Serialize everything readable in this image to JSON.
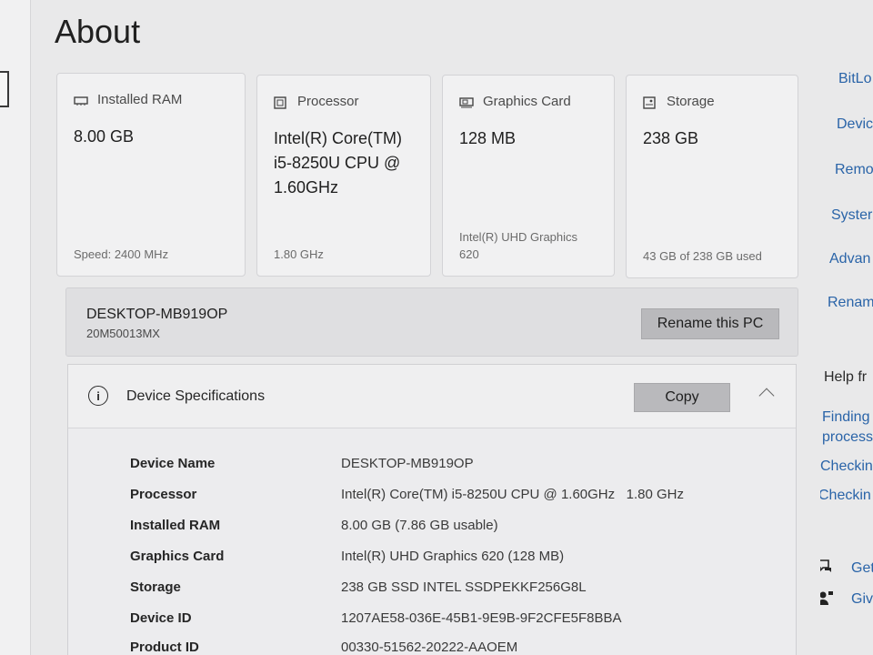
{
  "page": {
    "title": "About"
  },
  "cards": [
    {
      "icon": "ram-icon",
      "label": "Installed RAM",
      "value": "8.00 GB",
      "footer": "Speed: 2400 MHz"
    },
    {
      "icon": "processor-icon",
      "label": "Processor",
      "value_lines": [
        "Intel(R) Core(TM)",
        "i5-8250U CPU @",
        "1.60GHz"
      ],
      "footer": "1.80 GHz"
    },
    {
      "icon": "graphics-card-icon",
      "label": "Graphics Card",
      "value": "128 MB",
      "footer_lines": [
        "Intel(R) UHD Graphics",
        "620"
      ]
    },
    {
      "icon": "storage-icon",
      "label": "Storage",
      "value": "238 GB",
      "footer": "43 GB of 238 GB used"
    }
  ],
  "device": {
    "name": "DESKTOP-MB919OP",
    "model": "20M50013MX",
    "rename_label": "Rename this PC"
  },
  "specs": {
    "title": "Device Specifications",
    "copy_label": "Copy",
    "rows": [
      {
        "label": "Device Name",
        "value": "DESKTOP-MB919OP"
      },
      {
        "label": "Processor",
        "value": "Intel(R) Core(TM) i5-8250U CPU @ 1.60GHz   1.80 GHz"
      },
      {
        "label": "Installed RAM",
        "value": "8.00 GB (7.86 GB usable)"
      },
      {
        "label": "Graphics Card",
        "value": "Intel(R) UHD Graphics 620 (128 MB)"
      },
      {
        "label": "Storage",
        "value": "238 GB SSD INTEL SSDPEKKF256G8L"
      },
      {
        "label": "Device ID",
        "value": "1207AE58-036E-45B1-9E9B-9F2CFE5F8BBA"
      },
      {
        "label": "Product ID",
        "value": "00330-51562-20222-AAOEM"
      }
    ]
  },
  "related_links": [
    "BitLo",
    "Devic",
    "Remo",
    "Syster",
    "Advan",
    "Renam"
  ],
  "help": {
    "title": "Help fr",
    "links": [
      "Finding",
      "process",
      "Checkin",
      "Checkin"
    ],
    "get_help": "Get",
    "give_feedback": "Giv"
  }
}
